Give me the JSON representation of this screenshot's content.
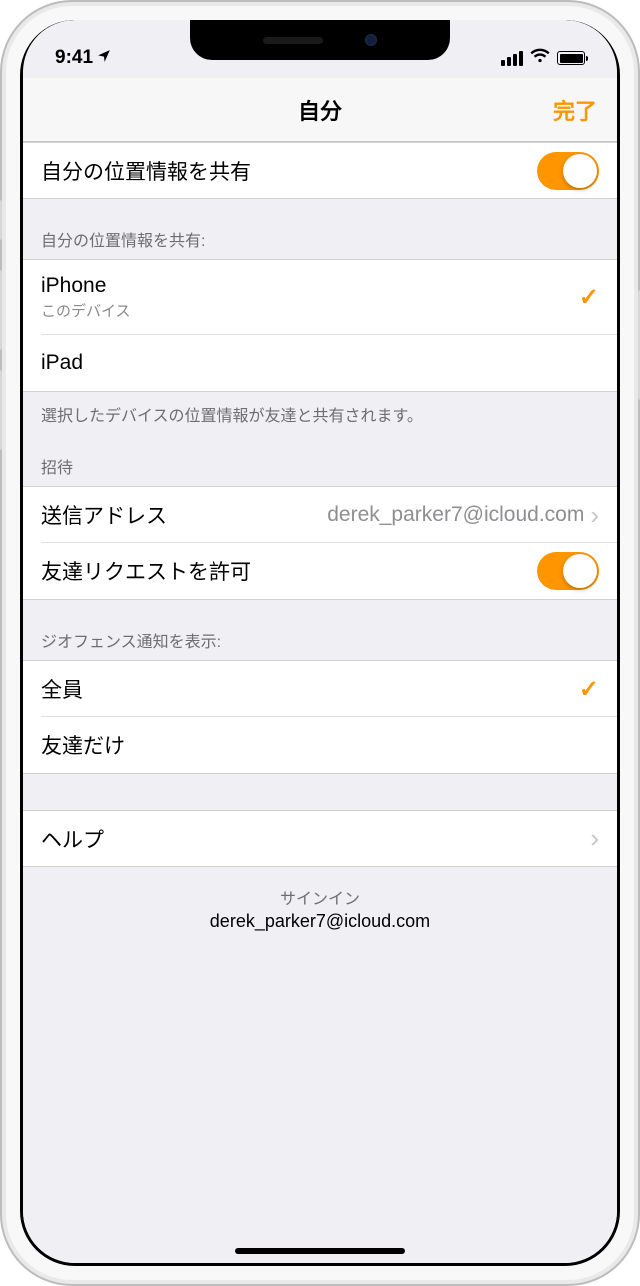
{
  "status": {
    "time": "9:41"
  },
  "nav": {
    "title": "自分",
    "done": "完了"
  },
  "share": {
    "label": "自分の位置情報を共有",
    "on": true
  },
  "devices": {
    "header": "自分の位置情報を共有:",
    "iphone": {
      "name": "iPhone",
      "sub": "このデバイス",
      "selected": true
    },
    "ipad": {
      "name": "iPad",
      "selected": false
    },
    "footer": "選択したデバイスの位置情報が友達と共有されます。"
  },
  "invite": {
    "header": "招待",
    "sendFromLabel": "送信アドレス",
    "sendFromValue": "derek_parker7@icloud.com",
    "allowRequestsLabel": "友達リクエストを許可",
    "allowRequestsOn": true
  },
  "geofence": {
    "header": "ジオフェンス通知を表示:",
    "everyone": {
      "label": "全員",
      "selected": true
    },
    "friends": {
      "label": "友達だけ",
      "selected": false
    }
  },
  "help": {
    "label": "ヘルプ"
  },
  "signin": {
    "label": "サインイン",
    "email": "derek_parker7@icloud.com"
  }
}
